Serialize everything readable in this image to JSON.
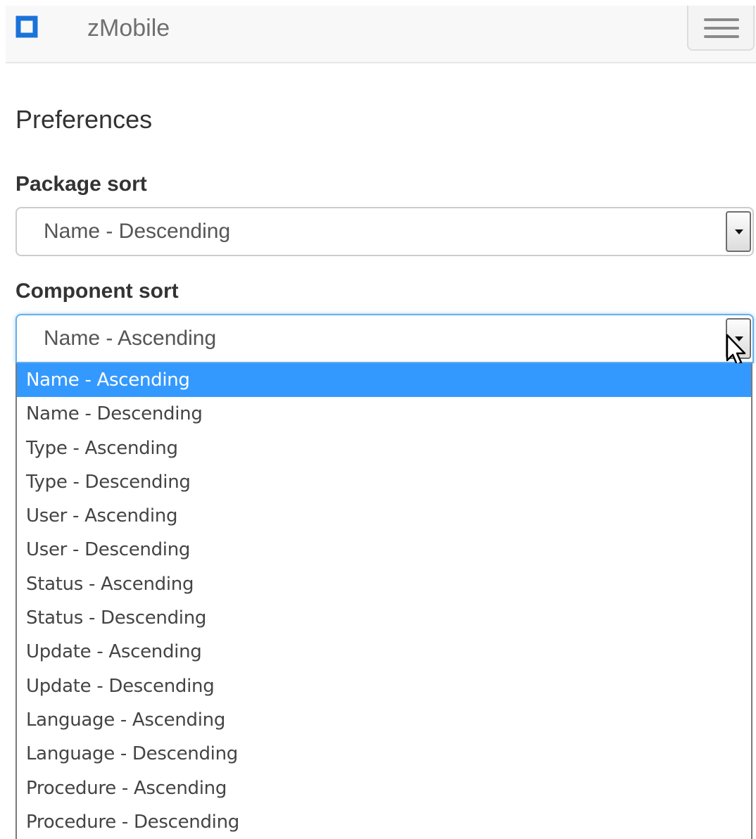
{
  "navbar": {
    "brand": "zMobile",
    "brand_color": "#1a73d9",
    "logo_icon": "square-outline-icon",
    "menu_icon": "hamburger-menu-icon"
  },
  "page": {
    "title": "Preferences"
  },
  "package_sort": {
    "label": "Package sort",
    "selected": "Name - Descending"
  },
  "component_sort": {
    "label": "Component sort",
    "selected": "Name - Ascending",
    "expanded": true,
    "options": [
      "Name - Ascending",
      "Name - Descending",
      "Type - Ascending",
      "Type - Descending",
      "User - Ascending",
      "User - Descending",
      "Status - Ascending",
      "Status - Descending",
      "Update - Ascending",
      "Update - Descending",
      "Language - Ascending",
      "Language - Descending",
      "Procedure - Ascending",
      "Procedure - Descending"
    ],
    "highlight_color": "#3399ff"
  }
}
